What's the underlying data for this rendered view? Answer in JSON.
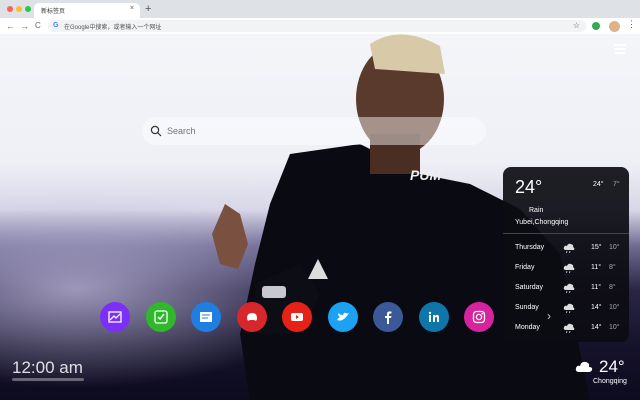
{
  "browser": {
    "traffic_colors": [
      "#ff5f57",
      "#febc2e",
      "#28c840"
    ],
    "tab_title": "新标签页",
    "tab_close": "×",
    "new_tab": "+",
    "omnibox_text": "在Google中搜索，或者输入一个网址",
    "back": "←",
    "forward": "→",
    "reload": "C",
    "star": "☆",
    "kebab": "⋮"
  },
  "page": {
    "search_placeholder": "Search",
    "weather": {
      "temp": "24°",
      "hi": "24°",
      "lo": "7°",
      "condition": "Rain",
      "location": "Yubei,Chongqing",
      "forecast": [
        {
          "day": "Thursday",
          "hi": "15°",
          "lo": "10°"
        },
        {
          "day": "Friday",
          "hi": "11°",
          "lo": "8°"
        },
        {
          "day": "Saturday",
          "hi": "11°",
          "lo": "8°"
        },
        {
          "day": "Sunday",
          "hi": "14°",
          "lo": "10°"
        },
        {
          "day": "Monday",
          "hi": "14°",
          "lo": "10°"
        }
      ]
    },
    "apps": [
      {
        "name": "gallery-app",
        "color": "#7b2ff7"
      },
      {
        "name": "tasks-app",
        "color": "#2fb82a"
      },
      {
        "name": "notes-app",
        "color": "#1f7fe0"
      },
      {
        "name": "games-app",
        "color": "#d8262d"
      },
      {
        "name": "youtube-app",
        "color": "#e62117"
      },
      {
        "name": "twitter-app",
        "color": "#1da1f2"
      },
      {
        "name": "facebook-app",
        "color": "#3b5998"
      },
      {
        "name": "linkedin-app",
        "color": "#0e76a8"
      },
      {
        "name": "instagram-app",
        "color": "#d6249f"
      }
    ],
    "more_arrow": "›",
    "clock": "12:00 am",
    "mini_weather": {
      "temp": "24°",
      "city": "Chongqing"
    }
  }
}
